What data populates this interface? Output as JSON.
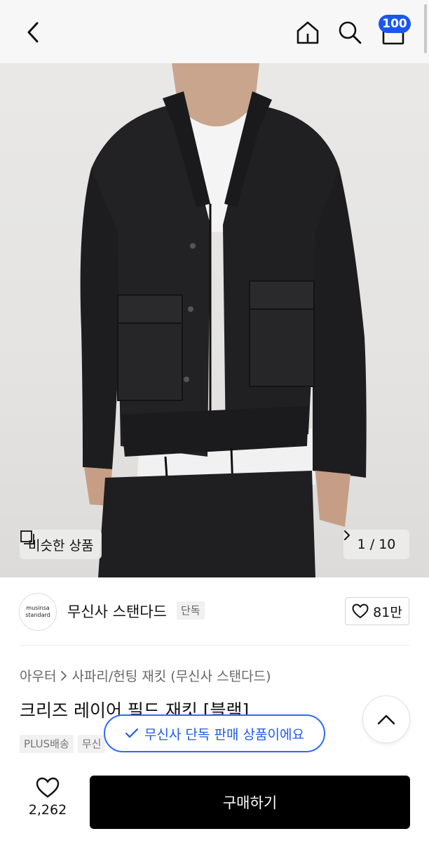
{
  "header": {
    "cart_count": "100"
  },
  "hero": {
    "similar_label": "비슷한 상품",
    "pager": "1 / 10"
  },
  "brand": {
    "logo_line1": "musinsa",
    "logo_line2": "standard",
    "name": "무신사 스탠다드",
    "tag": "단독",
    "like_count": "81만"
  },
  "product": {
    "breadcrumb": [
      "아우터",
      "사파리/헌팅 재킷 (무신사 스탠다드)"
    ],
    "title": "크리즈 레이어 필드 재킷 [블랙]",
    "chips": [
      "PLUS배송",
      "무신"
    ]
  },
  "toast": {
    "text": "무신사 단독 판매 상품이에요"
  },
  "bottom": {
    "wish_count": "2,262",
    "buy_label": "구매하기"
  },
  "colors": {
    "accent": "#2f6bf2",
    "badge": "#1a56f0",
    "buy_bg": "#000000"
  }
}
